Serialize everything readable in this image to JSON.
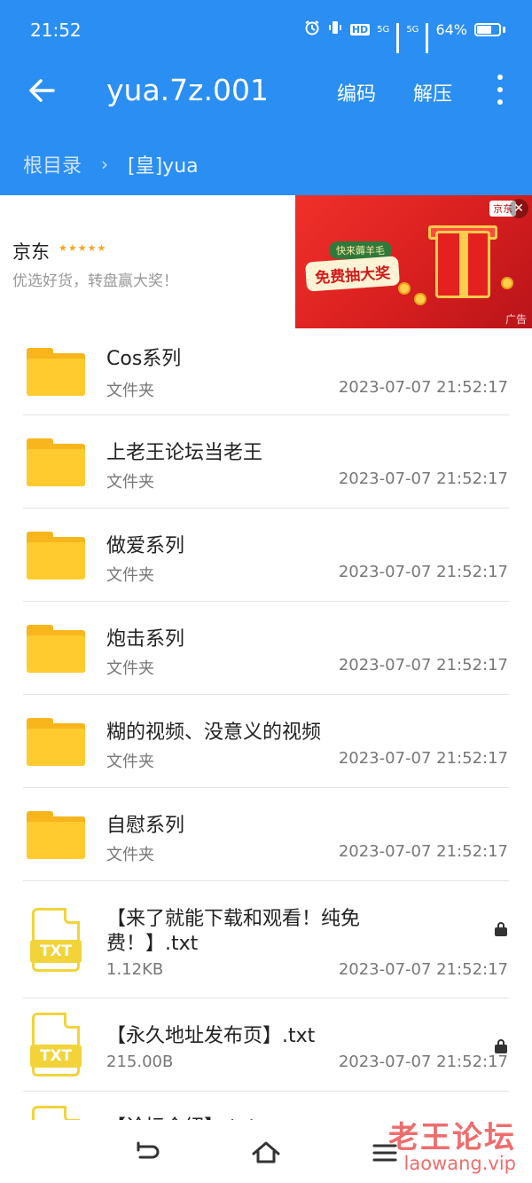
{
  "status_bar": {
    "time": "21:52",
    "network_1": "5G",
    "network_2": "5G",
    "hd_label": "HD",
    "battery": "64%"
  },
  "toolbar": {
    "title": "yua.7z.001",
    "encode_label": "编码",
    "extract_label": "解压"
  },
  "breadcrumb": {
    "root": "根目录",
    "separator": "›",
    "current": "[皇]yua"
  },
  "ad": {
    "brand": "京东",
    "stars": "★★★★★",
    "description": "优选好货，转盘赢大奖！",
    "tag": "快来薅羊毛",
    "headline": "免费抽大奖",
    "label": "广告",
    "logo": "京东"
  },
  "files": [
    {
      "name": "Cos系列",
      "meta": "文件夹",
      "date": "2023-07-07 21:52:17",
      "type": "folder"
    },
    {
      "name": "上老王论坛当老王",
      "meta": "文件夹",
      "date": "2023-07-07 21:52:17",
      "type": "folder"
    },
    {
      "name": "做爱系列",
      "meta": "文件夹",
      "date": "2023-07-07 21:52:17",
      "type": "folder"
    },
    {
      "name": "炮击系列",
      "meta": "文件夹",
      "date": "2023-07-07 21:52:17",
      "type": "folder"
    },
    {
      "name": "糊的视频、没意义的视频",
      "meta": "文件夹",
      "date": "2023-07-07 21:52:17",
      "type": "folder"
    },
    {
      "name": "自慰系列",
      "meta": "文件夹",
      "date": "2023-07-07 21:52:17",
      "type": "folder"
    },
    {
      "name_line1": "【来了就能下载和观看！纯免",
      "name_line2": "费！】.txt",
      "meta": "1.12KB",
      "date": "2023-07-07 21:52:17",
      "type": "txt",
      "locked": true
    },
    {
      "name": "【永久地址发布页】.txt",
      "meta": "215.00B",
      "date": "2023-07-07 21:52:17",
      "type": "txt",
      "locked": true
    },
    {
      "name": "【论坛介绍】.txt",
      "type": "txt"
    }
  ],
  "txt_badge": "TXT",
  "watermark": {
    "main": "老王论坛",
    "sub": "laowang.vip"
  },
  "colors": {
    "header": "#2b8ef3",
    "folder": "#ffcb2e",
    "txt": "#f3d33a",
    "watermark": "#e83c3c"
  },
  "icons": {
    "back": "arrow-left-icon",
    "more": "more-vertical-icon",
    "lock": "lock-icon",
    "nav_back": "nav-back-icon",
    "nav_home": "home-icon",
    "nav_menu": "menu-icon"
  }
}
